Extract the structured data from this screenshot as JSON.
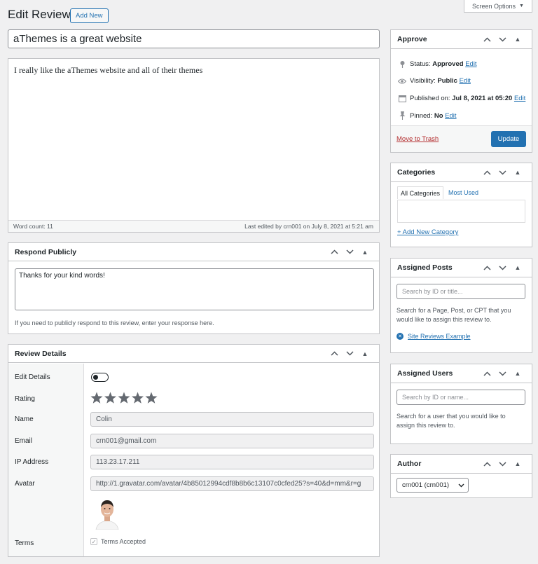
{
  "page": {
    "title": "Edit Review",
    "add_new": "Add New",
    "screen_options": "Screen Options"
  },
  "editor": {
    "title_value": "aThemes is a great website",
    "content": "I really like the aThemes website and all of their themes",
    "word_count": "Word count: 11",
    "last_edited": "Last edited by crn001 on July 8, 2021 at 5:21 am"
  },
  "respond": {
    "title": "Respond Publicly",
    "response": "Thanks for your kind words!",
    "help": "If you need to publicly respond to this review, enter your response here."
  },
  "details": {
    "title": "Review Details",
    "edit_details_label": "Edit Details",
    "rating_label": "Rating",
    "rating_value": 5,
    "rating_max": 5,
    "name_label": "Name",
    "name_value": "Colin",
    "email_label": "Email",
    "email_value": "crn001@gmail.com",
    "ip_label": "IP Address",
    "ip_value": "113.23.17.211",
    "avatar_label": "Avatar",
    "avatar_value": "http://1.gravatar.com/avatar/4b85012994cdf8b8b6c13107c0cfed25?s=40&d=mm&r=g",
    "terms_label": "Terms",
    "terms_value": "Terms Accepted"
  },
  "approve": {
    "title": "Approve",
    "status_label": "Status:",
    "status_value": "Approved",
    "visibility_label": "Visibility:",
    "visibility_value": "Public",
    "published_label": "Published on:",
    "published_value": "Jul 8, 2021 at 05:20",
    "pinned_label": "Pinned:",
    "pinned_value": "No",
    "edit": "Edit",
    "trash": "Move to Trash",
    "update": "Update"
  },
  "categories": {
    "title": "Categories",
    "tab_all": "All Categories",
    "tab_used": "Most Used",
    "add": "+ Add New Category"
  },
  "posts": {
    "title": "Assigned Posts",
    "placeholder": "Search by ID or title...",
    "help": "Search for a Page, Post, or CPT that you would like to assign this review to.",
    "example": "Site Reviews Example"
  },
  "users": {
    "title": "Assigned Users",
    "placeholder": "Search by ID or name...",
    "help": "Search for a user that you would like to assign this review to."
  },
  "author": {
    "title": "Author",
    "selected": "crn001 (crn001)"
  },
  "colors": {
    "accent": "#2271b1",
    "trash": "#b32d2e",
    "star": "#646970"
  }
}
